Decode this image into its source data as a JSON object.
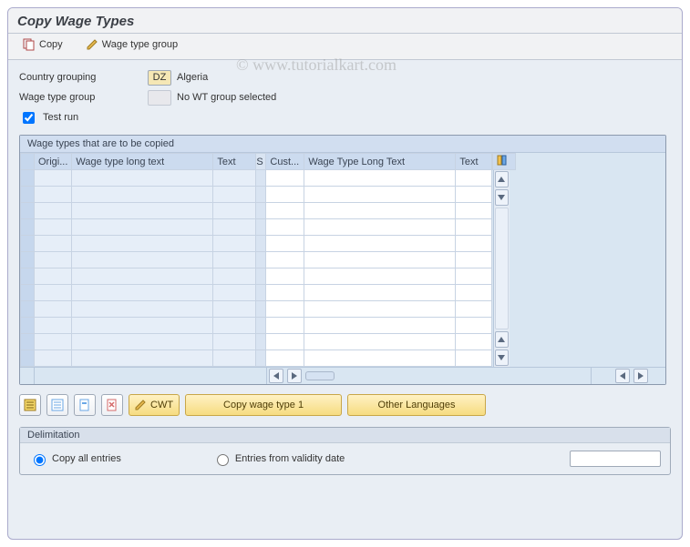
{
  "header": {
    "title": "Copy Wage Types"
  },
  "toolbar": {
    "copy_label": "Copy",
    "wage_type_group_label": "Wage type group"
  },
  "form": {
    "country_label": "Country grouping",
    "country_value": "DZ",
    "country_name": "Algeria",
    "wtg_label": "Wage type group",
    "wtg_desc": "No WT group selected",
    "test_run_label": "Test run",
    "test_run_checked": true
  },
  "table": {
    "caption": "Wage types that are to be copied",
    "cols": {
      "origi": "Origi...",
      "wlt1": "Wage type long text",
      "text1": "Text",
      "s": "S",
      "cust": "Cust...",
      "wlt2": "Wage Type Long Text",
      "text2": "Text"
    },
    "row_count": 12
  },
  "actions": {
    "cwt_label": "CWT",
    "copy_wt1_label": "Copy wage type 1",
    "other_lang_label": "Other Languages"
  },
  "delim": {
    "title": "Delimitation",
    "opt_all": "Copy all entries",
    "opt_from": "Entries from validity date",
    "date_value": ""
  },
  "watermark": "©  www.tutorialkart.com"
}
